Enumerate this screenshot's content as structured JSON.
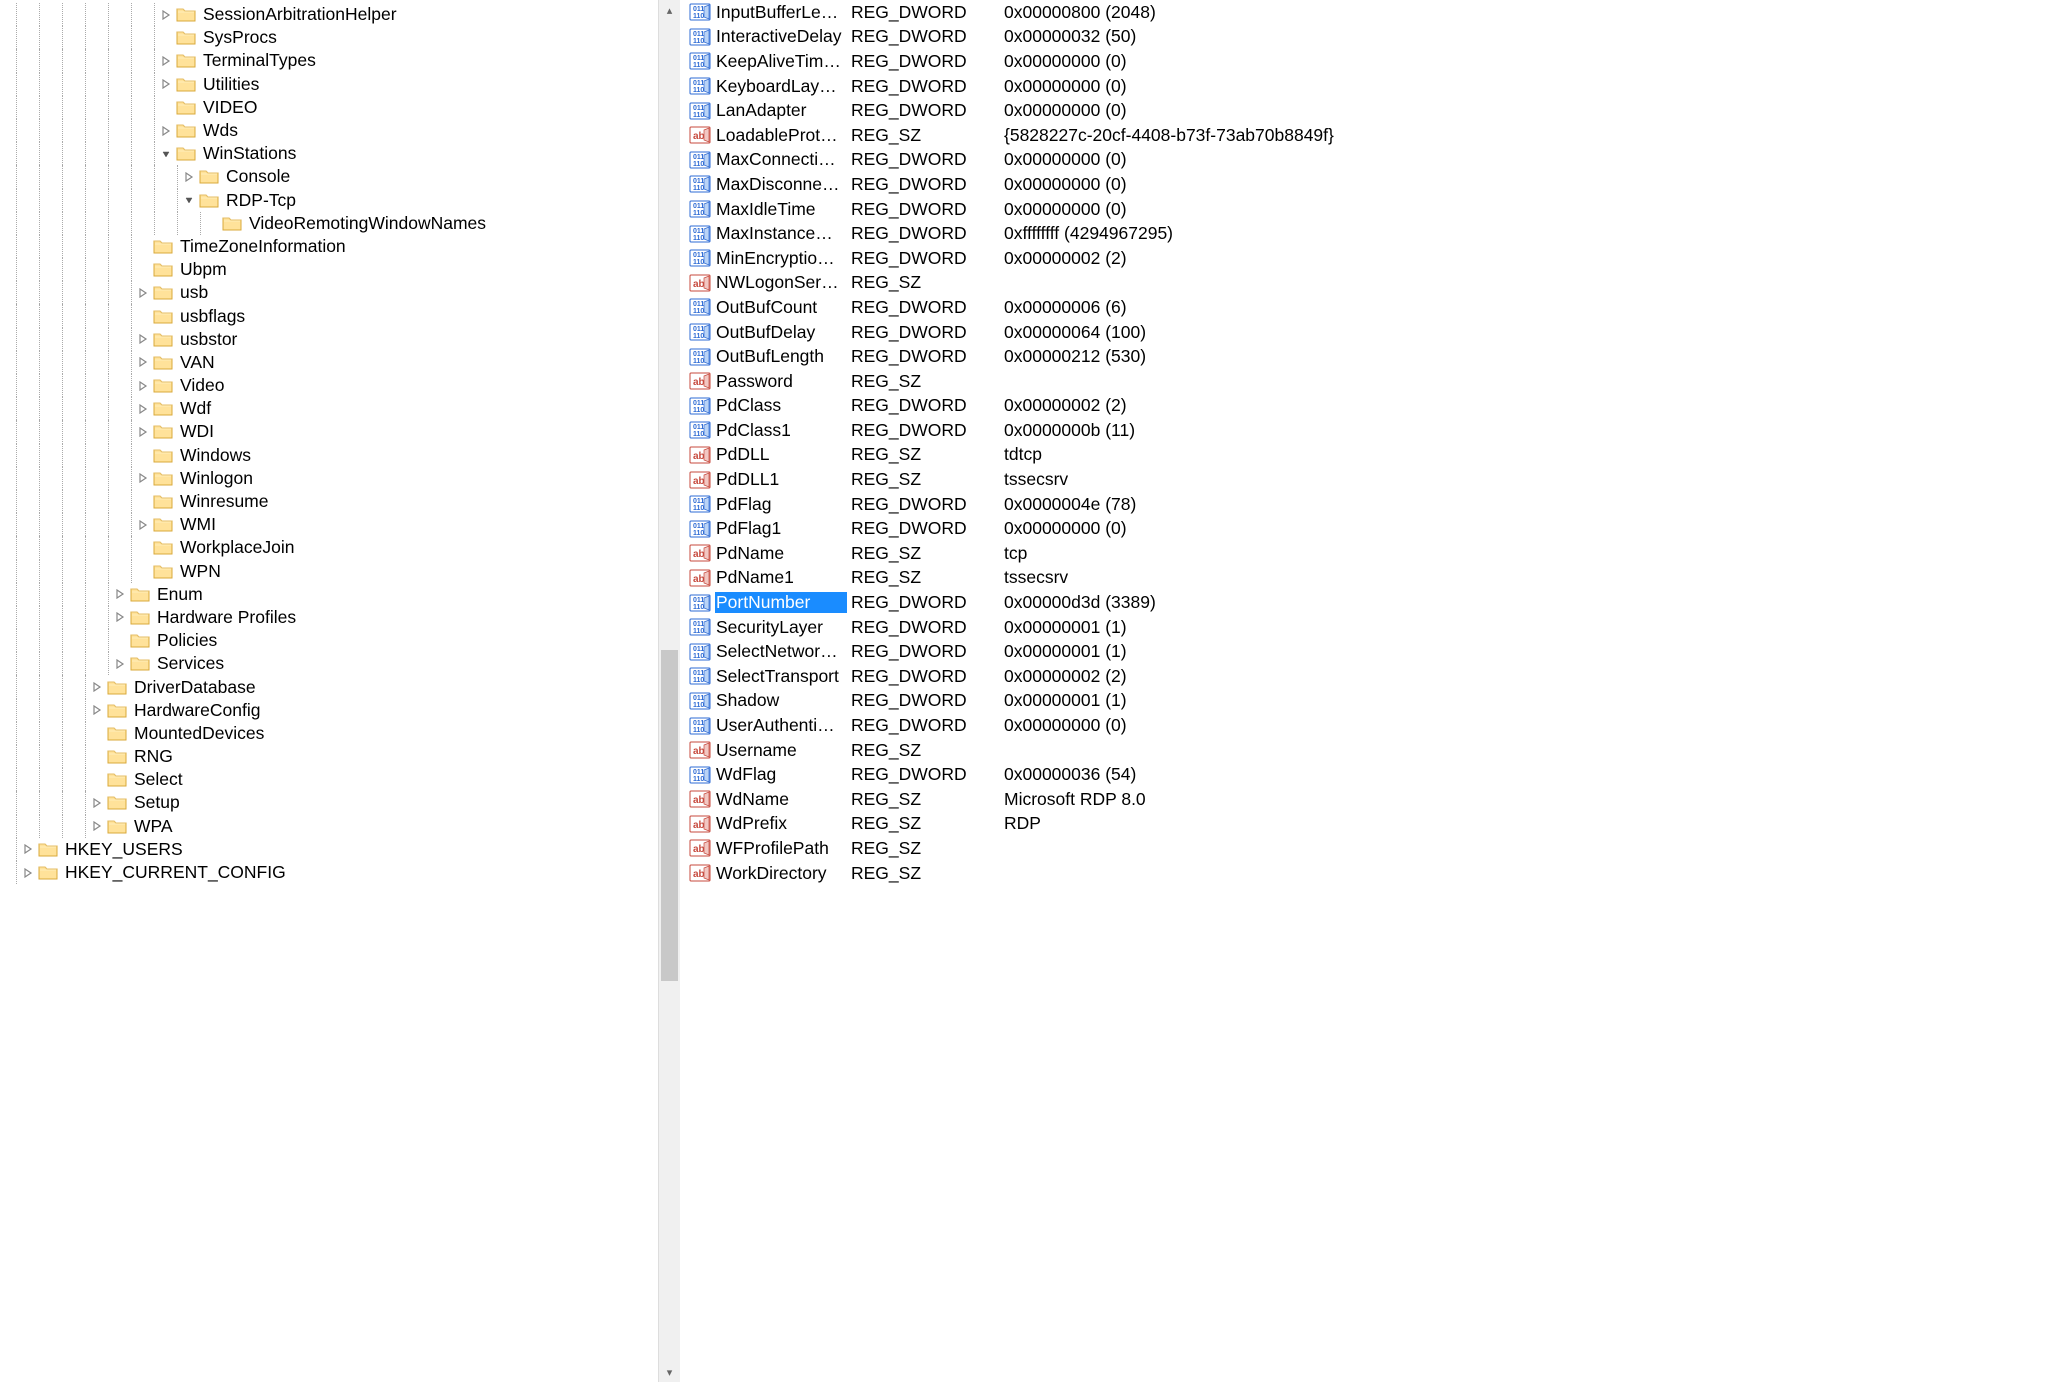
{
  "tree": [
    {
      "indent": 7,
      "exp": "closed",
      "label": "SessionArbitrationHelper"
    },
    {
      "indent": 7,
      "exp": "none",
      "label": "SysProcs"
    },
    {
      "indent": 7,
      "exp": "closed",
      "label": "TerminalTypes"
    },
    {
      "indent": 7,
      "exp": "closed",
      "label": "Utilities"
    },
    {
      "indent": 7,
      "exp": "none",
      "label": "VIDEO"
    },
    {
      "indent": 7,
      "exp": "closed",
      "label": "Wds"
    },
    {
      "indent": 7,
      "exp": "open",
      "label": "WinStations"
    },
    {
      "indent": 8,
      "exp": "closed",
      "label": "Console"
    },
    {
      "indent": 8,
      "exp": "open",
      "label": "RDP-Tcp",
      "selected": true
    },
    {
      "indent": 9,
      "exp": "none",
      "label": "VideoRemotingWindowNames"
    },
    {
      "indent": 6,
      "exp": "none",
      "label": "TimeZoneInformation"
    },
    {
      "indent": 6,
      "exp": "none",
      "label": "Ubpm"
    },
    {
      "indent": 6,
      "exp": "closed",
      "label": "usb"
    },
    {
      "indent": 6,
      "exp": "none",
      "label": "usbflags"
    },
    {
      "indent": 6,
      "exp": "closed",
      "label": "usbstor"
    },
    {
      "indent": 6,
      "exp": "closed",
      "label": "VAN"
    },
    {
      "indent": 6,
      "exp": "closed",
      "label": "Video"
    },
    {
      "indent": 6,
      "exp": "closed",
      "label": "Wdf"
    },
    {
      "indent": 6,
      "exp": "closed",
      "label": "WDI"
    },
    {
      "indent": 6,
      "exp": "none",
      "label": "Windows"
    },
    {
      "indent": 6,
      "exp": "closed",
      "label": "Winlogon"
    },
    {
      "indent": 6,
      "exp": "none",
      "label": "Winresume"
    },
    {
      "indent": 6,
      "exp": "closed",
      "label": "WMI"
    },
    {
      "indent": 6,
      "exp": "none",
      "label": "WorkplaceJoin"
    },
    {
      "indent": 6,
      "exp": "none",
      "label": "WPN"
    },
    {
      "indent": 5,
      "exp": "closed",
      "label": "Enum"
    },
    {
      "indent": 5,
      "exp": "closed",
      "label": "Hardware Profiles"
    },
    {
      "indent": 5,
      "exp": "none",
      "label": "Policies"
    },
    {
      "indent": 5,
      "exp": "closed",
      "label": "Services"
    },
    {
      "indent": 4,
      "exp": "closed",
      "label": "DriverDatabase"
    },
    {
      "indent": 4,
      "exp": "closed",
      "label": "HardwareConfig"
    },
    {
      "indent": 4,
      "exp": "none",
      "label": "MountedDevices"
    },
    {
      "indent": 4,
      "exp": "none",
      "label": "RNG"
    },
    {
      "indent": 4,
      "exp": "none",
      "label": "Select"
    },
    {
      "indent": 4,
      "exp": "closed",
      "label": "Setup"
    },
    {
      "indent": 4,
      "exp": "closed",
      "label": "WPA"
    },
    {
      "indent": 1,
      "exp": "closed",
      "label": "HKEY_USERS"
    },
    {
      "indent": 1,
      "exp": "closed",
      "label": "HKEY_CURRENT_CONFIG"
    }
  ],
  "values": [
    {
      "icon": "dword",
      "name": "InputBufferLeng...",
      "type": "REG_DWORD",
      "data": "0x00000800 (2048)"
    },
    {
      "icon": "dword",
      "name": "InteractiveDelay",
      "type": "REG_DWORD",
      "data": "0x00000032 (50)"
    },
    {
      "icon": "dword",
      "name": "KeepAliveTimeo...",
      "type": "REG_DWORD",
      "data": "0x00000000 (0)"
    },
    {
      "icon": "dword",
      "name": "KeyboardLayout",
      "type": "REG_DWORD",
      "data": "0x00000000 (0)"
    },
    {
      "icon": "dword",
      "name": "LanAdapter",
      "type": "REG_DWORD",
      "data": "0x00000000 (0)"
    },
    {
      "icon": "string",
      "name": "LoadableProtoc...",
      "type": "REG_SZ",
      "data": "{5828227c-20cf-4408-b73f-73ab70b8849f}"
    },
    {
      "icon": "dword",
      "name": "MaxConnection...",
      "type": "REG_DWORD",
      "data": "0x00000000 (0)"
    },
    {
      "icon": "dword",
      "name": "MaxDisconnecti...",
      "type": "REG_DWORD",
      "data": "0x00000000 (0)"
    },
    {
      "icon": "dword",
      "name": "MaxIdleTime",
      "type": "REG_DWORD",
      "data": "0x00000000 (0)"
    },
    {
      "icon": "dword",
      "name": "MaxInstanceCo...",
      "type": "REG_DWORD",
      "data": "0xffffffff (4294967295)"
    },
    {
      "icon": "dword",
      "name": "MinEncryptionL...",
      "type": "REG_DWORD",
      "data": "0x00000002 (2)"
    },
    {
      "icon": "string",
      "name": "NWLogonServer",
      "type": "REG_SZ",
      "data": ""
    },
    {
      "icon": "dword",
      "name": "OutBufCount",
      "type": "REG_DWORD",
      "data": "0x00000006 (6)"
    },
    {
      "icon": "dword",
      "name": "OutBufDelay",
      "type": "REG_DWORD",
      "data": "0x00000064 (100)"
    },
    {
      "icon": "dword",
      "name": "OutBufLength",
      "type": "REG_DWORD",
      "data": "0x00000212 (530)"
    },
    {
      "icon": "string",
      "name": "Password",
      "type": "REG_SZ",
      "data": ""
    },
    {
      "icon": "dword",
      "name": "PdClass",
      "type": "REG_DWORD",
      "data": "0x00000002 (2)"
    },
    {
      "icon": "dword",
      "name": "PdClass1",
      "type": "REG_DWORD",
      "data": "0x0000000b (11)"
    },
    {
      "icon": "string",
      "name": "PdDLL",
      "type": "REG_SZ",
      "data": "tdtcp"
    },
    {
      "icon": "string",
      "name": "PdDLL1",
      "type": "REG_SZ",
      "data": "tssecsrv"
    },
    {
      "icon": "dword",
      "name": "PdFlag",
      "type": "REG_DWORD",
      "data": "0x0000004e (78)"
    },
    {
      "icon": "dword",
      "name": "PdFlag1",
      "type": "REG_DWORD",
      "data": "0x00000000 (0)"
    },
    {
      "icon": "string",
      "name": "PdName",
      "type": "REG_SZ",
      "data": "tcp"
    },
    {
      "icon": "string",
      "name": "PdName1",
      "type": "REG_SZ",
      "data": "tssecsrv"
    },
    {
      "icon": "dword",
      "name": "PortNumber",
      "type": "REG_DWORD",
      "data": "0x00000d3d (3389)",
      "selected": true
    },
    {
      "icon": "dword",
      "name": "SecurityLayer",
      "type": "REG_DWORD",
      "data": "0x00000001 (1)"
    },
    {
      "icon": "dword",
      "name": "SelectNetworkD...",
      "type": "REG_DWORD",
      "data": "0x00000001 (1)"
    },
    {
      "icon": "dword",
      "name": "SelectTransport",
      "type": "REG_DWORD",
      "data": "0x00000002 (2)"
    },
    {
      "icon": "dword",
      "name": "Shadow",
      "type": "REG_DWORD",
      "data": "0x00000001 (1)"
    },
    {
      "icon": "dword",
      "name": "UserAuthenticat...",
      "type": "REG_DWORD",
      "data": "0x00000000 (0)"
    },
    {
      "icon": "string",
      "name": "Username",
      "type": "REG_SZ",
      "data": ""
    },
    {
      "icon": "dword",
      "name": "WdFlag",
      "type": "REG_DWORD",
      "data": "0x00000036 (54)"
    },
    {
      "icon": "string",
      "name": "WdName",
      "type": "REG_SZ",
      "data": "Microsoft RDP 8.0"
    },
    {
      "icon": "string",
      "name": "WdPrefix",
      "type": "REG_SZ",
      "data": "RDP"
    },
    {
      "icon": "string",
      "name": "WFProfilePath",
      "type": "REG_SZ",
      "data": ""
    },
    {
      "icon": "string",
      "name": "WorkDirectory",
      "type": "REG_SZ",
      "data": ""
    }
  ],
  "scroll": {
    "thumb_top_pct": 47,
    "thumb_height_pct": 24
  }
}
